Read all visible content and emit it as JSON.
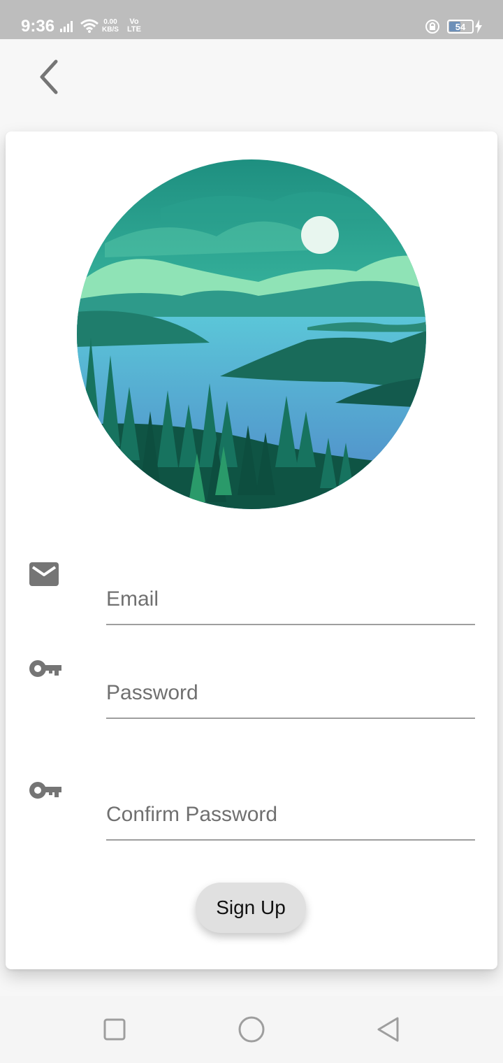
{
  "status_bar": {
    "time": "9:36",
    "net_speed_value": "0.00",
    "net_speed_unit": "KB/S",
    "volte_top": "Vo",
    "volte_bottom": "LTE",
    "battery_level": "54",
    "battery_fraction": 0.54,
    "icons": [
      "signal-icon",
      "wifi-icon",
      "lock-rotation-icon",
      "battery-icon",
      "charging-icon"
    ]
  },
  "app_bar": {
    "back_icon": "chevron-left-icon"
  },
  "hero": {
    "image_name": "lake-landscape-illustration"
  },
  "form": {
    "email": {
      "placeholder": "Email",
      "value": "",
      "icon": "mail-icon"
    },
    "password": {
      "placeholder": "Password",
      "value": "",
      "icon": "key-icon"
    },
    "confirm_password": {
      "placeholder": "Confirm Password",
      "value": "",
      "icon": "key-icon"
    },
    "submit_label": "Sign Up"
  },
  "nav_bar": {
    "icons": [
      "recents-square-icon",
      "home-circle-icon",
      "back-triangle-icon"
    ]
  },
  "colors": {
    "status_bar": "#bdbdbd",
    "background": "#f7f7f7",
    "card": "#ffffff",
    "icon_gray": "#757575",
    "button": "#e0e0e0",
    "underline": "#9e9e9e"
  }
}
